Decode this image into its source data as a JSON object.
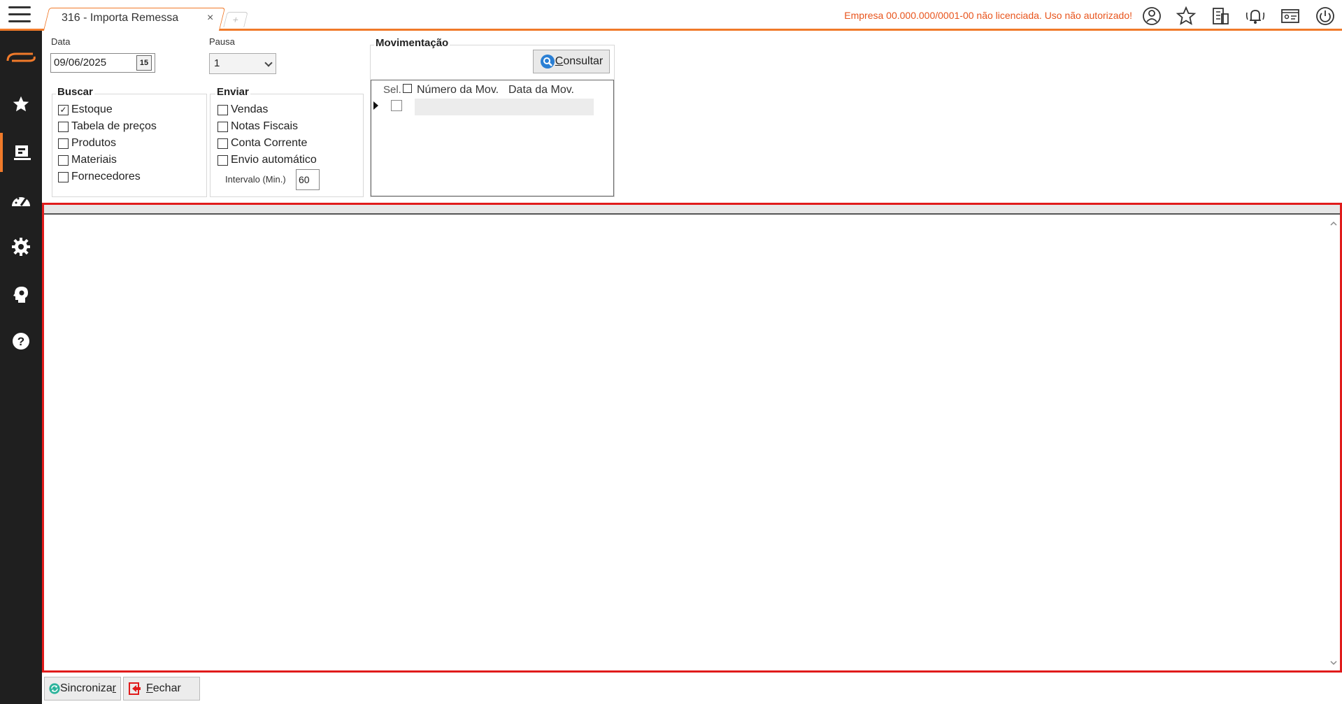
{
  "tab": {
    "title": "316 - Importa Remessa",
    "close": "×",
    "add": "+"
  },
  "header": {
    "license_message": "Empresa 00.000.000/0001-00 não licenciada. Uso não autorizado!"
  },
  "colors": {
    "accent": "#f07a2a",
    "highlight_border": "#e01b1b",
    "warning_text": "#e8541c",
    "sidebar_bg": "#1f1f1f"
  },
  "icons": {
    "top": [
      "user-icon",
      "star-icon",
      "building-icon",
      "bell-icon",
      "id-card-icon",
      "power-icon"
    ],
    "sidebar": [
      "logo-icon",
      "favorites-icon",
      "records-icon",
      "dashboard-icon",
      "settings-icon",
      "knowledge-icon",
      "help-icon"
    ]
  },
  "form": {
    "data_label": "Data",
    "data_value": "09/06/2025",
    "date_button": "15",
    "pausa_label": "Pausa",
    "pausa_value": "1",
    "buscar": {
      "title": "Buscar",
      "items": [
        {
          "label": "Estoque",
          "checked": true
        },
        {
          "label": "Tabela de preços",
          "checked": false
        },
        {
          "label": "Produtos",
          "checked": false
        },
        {
          "label": "Materiais",
          "checked": false
        },
        {
          "label": "Fornecedores",
          "checked": false
        }
      ]
    },
    "enviar": {
      "title": "Enviar",
      "items": [
        {
          "label": "Vendas",
          "checked": false
        },
        {
          "label": "Notas Fiscais",
          "checked": false
        },
        {
          "label": "Conta Corrente",
          "checked": false
        },
        {
          "label": "Envio automático",
          "checked": false
        }
      ],
      "interval_label": "Intervalo (Min.)",
      "interval_value": "60"
    },
    "movimentacao": {
      "title": "Movimentação",
      "consultar_pre": "",
      "consultar_hot": "C",
      "consultar_rest": "onsultar",
      "columns": [
        "Sel.",
        "Número da Mov.",
        "Data da Mov."
      ]
    }
  },
  "footer": {
    "sync_pre": "Sincroniza",
    "sync_hot": "r",
    "fechar_hot": "F",
    "fechar_rest": "echar"
  }
}
